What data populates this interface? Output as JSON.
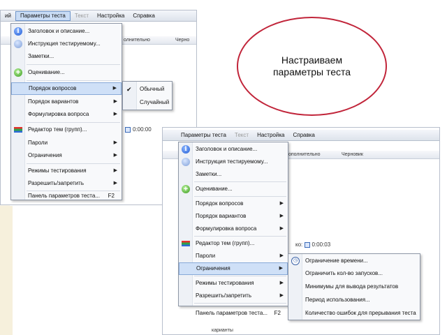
{
  "callout": {
    "line1": "Настраиваем",
    "line2": "параметры теста"
  },
  "menubar": {
    "items": [
      "ий",
      "Параметры теста",
      "Текст",
      "Настройка",
      "Справка"
    ]
  },
  "toolbar1": {
    "text1": "олнительно",
    "text2": "Черно"
  },
  "toolbar2": {
    "text1": "ополнительно",
    "text2": "Черновик"
  },
  "timer1": {
    "value": "0:00:00"
  },
  "timer2": {
    "label": "ко:",
    "value": "0:00:03"
  },
  "main_menu": {
    "items": [
      {
        "label": "Заголовок и описание...",
        "icon": "info-icon"
      },
      {
        "label": "Инструкция тестируемому...",
        "icon": "instruction-icon"
      },
      {
        "label": "Заметки..."
      },
      {
        "label": "Оценивание...",
        "icon": "plus-icon"
      },
      {
        "label": "Порядок вопросов"
      },
      {
        "label": "Порядок вариантов"
      },
      {
        "label": "Формулировка вопроса"
      },
      {
        "label": "Редактор тем (групп)...",
        "icon": "topic-editor-icon"
      },
      {
        "label": "Пароли"
      },
      {
        "label": "Ограничения"
      },
      {
        "label": "Режимы тестирования"
      },
      {
        "label": "Разрешить/запретить"
      },
      {
        "label": "Панель параметров теста...",
        "shortcut": "F2"
      }
    ]
  },
  "order_submenu": {
    "items": [
      "Обычный",
      "Случайный"
    ]
  },
  "limits_submenu": {
    "items": [
      "Ограничение времени...",
      "Ограничить кол-во запусков...",
      "Минимумы для вывода результатов",
      "Период использования...",
      "Количество ошибок для прерывания теста"
    ]
  },
  "bottom_text": "карианты",
  "colors": {
    "accent_border": "#c1253a",
    "highlight": "#cfe0f7",
    "menu_bg": "#f8f9fb"
  }
}
